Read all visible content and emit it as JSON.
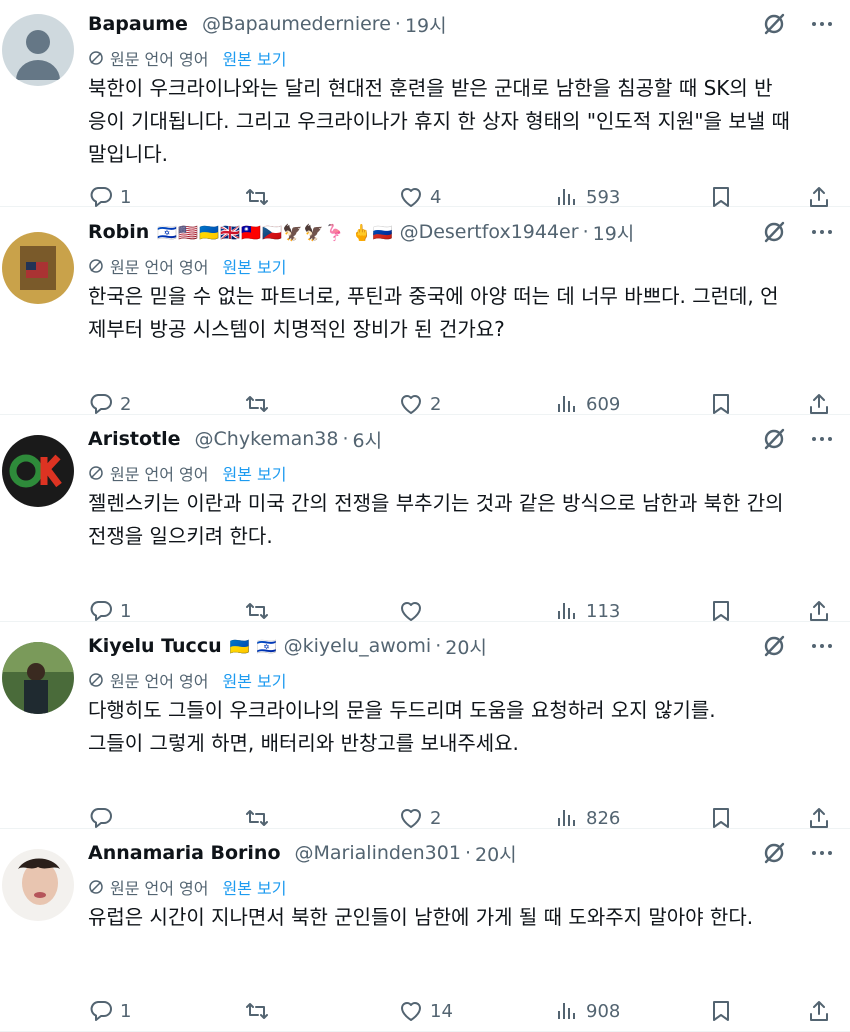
{
  "ui": {
    "translate_label": "원문 언어 영어",
    "show_original": "원본 보기"
  },
  "tweets": [
    {
      "name": "Bapaume",
      "flags": "",
      "handle": "@Bapaumederniere",
      "time": "19시",
      "text_lines": [
        "북한이 우크라이나와는 달리 현대전 훈련을 받은 군대로 남한을 침공할 때 SK의 반",
        "응이 기대됩니다. 그리고 우크라이나가 휴지 한 상자 형태의 \"인도적 지원\"을 보낼 때",
        "말입니다."
      ],
      "replies": "1",
      "retweets": "",
      "likes": "4",
      "views": "593",
      "avatar_color": "#cfd9de"
    },
    {
      "name": "Robin",
      "flags": "🇮🇱🇺🇸🇺🇦🇬🇧🇹🇼🇨🇿🦅🦅🦩 🖕🇷🇺",
      "handle": "@Desertfox1944er",
      "time": "19시",
      "text_lines": [
        "한국은 믿을 수 없는 파트너로, 푸틴과 중국에 아양 떠는 데 너무 바쁘다. 그런데, 언",
        "제부터 방공 시스템이 치명적인 장비가 된 건가요?"
      ],
      "replies": "2",
      "retweets": "",
      "likes": "2",
      "views": "609",
      "avatar_color": "#c9a24a"
    },
    {
      "name": "Aristotle",
      "flags": "",
      "handle": "@Chykeman38",
      "time": "6시",
      "text_lines": [
        "젤렌스키는 이란과 미국 간의 전쟁을 부추기는 것과 같은 방식으로 남한과 북한 간의",
        "전쟁을 일으키려 한다."
      ],
      "replies": "1",
      "retweets": "",
      "likes": "",
      "views": "113",
      "avatar_color": "#1a1a1a"
    },
    {
      "name": "Kiyelu Tuccu",
      "flags": "🇺🇦 🇮🇱",
      "handle": "@kiyelu_awomi",
      "time": "20시",
      "text_lines": [
        "다행히도 그들이 우크라이나의 문을 두드리며 도움을 요청하러 오지 않기를.",
        "그들이 그렇게 하면, 배터리와 반창고를 보내주세요."
      ],
      "replies": "",
      "retweets": "",
      "likes": "2",
      "views": "826",
      "avatar_color": "#4a6b3a"
    },
    {
      "name": "Annamaria Borino",
      "flags": "",
      "handle": "@Marialinden301",
      "time": "20시",
      "text_lines": [
        "유럽은 시간이 지나면서 북한 군인들이 남한에 가게 될 때 도와주지 말아야 한다."
      ],
      "replies": "1",
      "retweets": "",
      "likes": "14",
      "views": "908",
      "avatar_color": "#e8c5b0"
    }
  ]
}
